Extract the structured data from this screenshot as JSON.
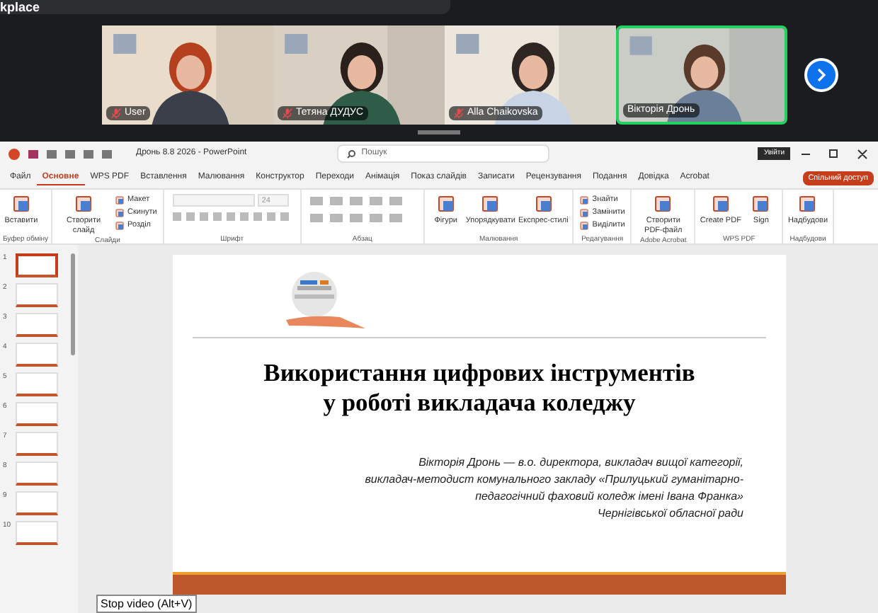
{
  "top_bar": {
    "title": "kplace"
  },
  "participants": [
    {
      "name": "User",
      "muted": true,
      "speaking": false
    },
    {
      "name": "Тетяна ДУДУС",
      "muted": true,
      "speaking": false
    },
    {
      "name": "Alla Chaikovska",
      "muted": true,
      "speaking": false
    },
    {
      "name": "Вікторія Дронь",
      "muted": false,
      "speaking": true
    }
  ],
  "powerpoint": {
    "title": "Дронь 8.8 2026  -  PowerPoint",
    "search": {
      "placeholder": "Пошук"
    },
    "sign_in": "Увійти",
    "tabs": [
      {
        "label": "Файл",
        "selected": false
      },
      {
        "label": "Основне",
        "selected": true
      },
      {
        "label": "WPS PDF",
        "selected": false
      },
      {
        "label": "Вставлення",
        "selected": false
      },
      {
        "label": "Малювання",
        "selected": false
      },
      {
        "label": "Конструктор",
        "selected": false
      },
      {
        "label": "Переходи",
        "selected": false
      },
      {
        "label": "Анімація",
        "selected": false
      },
      {
        "label": "Показ слайдів",
        "selected": false
      },
      {
        "label": "Записати",
        "selected": false
      },
      {
        "label": "Рецензування",
        "selected": false
      },
      {
        "label": "Подання",
        "selected": false
      },
      {
        "label": "Довідка",
        "selected": false
      },
      {
        "label": "Acrobat",
        "selected": false
      }
    ],
    "share": "Спільний доступ",
    "ribbon": [
      {
        "label": "Буфер обміну",
        "buttons": [
          {
            "kind": "big",
            "label": "Вставити"
          }
        ]
      },
      {
        "label": "Слайди",
        "buttons": [
          {
            "kind": "big",
            "label": "Створити слайд"
          },
          {
            "kind": "small",
            "label": "Макет"
          },
          {
            "kind": "small",
            "label": "Скинути"
          },
          {
            "kind": "small",
            "label": "Розділ"
          }
        ]
      },
      {
        "label": "Шрифт",
        "buttons": [
          {
            "kind": "font",
            "label": "24"
          }
        ]
      },
      {
        "label": "Абзац",
        "buttons": [
          {
            "kind": "para"
          }
        ]
      },
      {
        "label": "Малювання",
        "buttons": [
          {
            "kind": "big",
            "label": "Фігури"
          },
          {
            "kind": "big",
            "label": "Упорядкувати"
          },
          {
            "kind": "big",
            "label": "Експрес-стилі"
          }
        ]
      },
      {
        "label": "Редагування",
        "buttons": [
          {
            "kind": "small",
            "label": "Знайти"
          },
          {
            "kind": "small",
            "label": "Замінити"
          },
          {
            "kind": "small",
            "label": "Виділити"
          }
        ]
      },
      {
        "label": "Adobe Acrobat",
        "buttons": [
          {
            "kind": "big",
            "label": "Створити PDF-файл"
          }
        ]
      },
      {
        "label": "WPS PDF",
        "buttons": [
          {
            "kind": "big",
            "label": "Create PDF"
          },
          {
            "kind": "big",
            "label": "Sign"
          }
        ]
      },
      {
        "label": "Надбудови",
        "buttons": [
          {
            "kind": "big",
            "label": "Надбудови"
          }
        ]
      }
    ],
    "thumbnails": [
      {
        "number": "1",
        "selected": true
      },
      {
        "number": "2",
        "selected": false
      },
      {
        "number": "3",
        "selected": false
      },
      {
        "number": "4",
        "selected": false
      },
      {
        "number": "5",
        "selected": false
      },
      {
        "number": "6",
        "selected": false
      },
      {
        "number": "7",
        "selected": false
      },
      {
        "number": "8",
        "selected": false
      },
      {
        "number": "9",
        "selected": false
      },
      {
        "number": "10",
        "selected": false
      }
    ],
    "slide": {
      "logo": {
        "kind": "picture"
      },
      "title_lines": [
        "Використання цифрових інструментів",
        "у роботі викладача коледжу"
      ],
      "author_lines": [
        "Вікторія Дронь — в.о. директора, викладач вищої категорії,",
        "викладач-методист комунального закладу «Прилуцький гуманітарно-",
        "педагогічний фаховий коледж імені Івана Франка»",
        "Чернігівської обласної ради"
      ]
    }
  },
  "tooltip": "Stop video (Alt+V)"
}
